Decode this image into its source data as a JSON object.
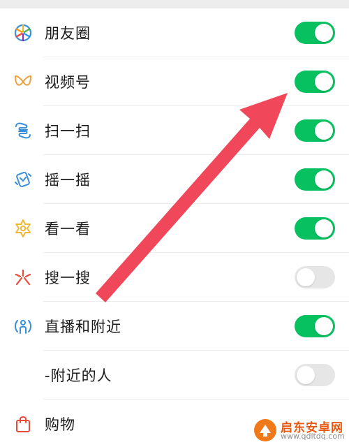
{
  "settings": {
    "items": [
      {
        "label": "朋友圈",
        "icon": "moments-icon",
        "enabled": true
      },
      {
        "label": "视频号",
        "icon": "channels-icon",
        "enabled": true
      },
      {
        "label": "扫一扫",
        "icon": "scan-icon",
        "enabled": true
      },
      {
        "label": "摇一摇",
        "icon": "shake-icon",
        "enabled": true
      },
      {
        "label": "看一看",
        "icon": "top-stories-icon",
        "enabled": true
      },
      {
        "label": "搜一搜",
        "icon": "search-icon",
        "enabled": false
      },
      {
        "label": "直播和附近",
        "icon": "live-nearby-icon",
        "enabled": true
      },
      {
        "label": "-附近的人",
        "icon": "",
        "enabled": false
      },
      {
        "label": "购物",
        "icon": "shopping-bag-icon",
        "enabled": null
      }
    ]
  },
  "watermark": {
    "name": "启东安卓网",
    "url": "www.qdltdq.com"
  },
  "colors": {
    "toggle_on": "#07c160",
    "toggle_off": "#e6e6e6",
    "arrow": "#f0485a"
  }
}
